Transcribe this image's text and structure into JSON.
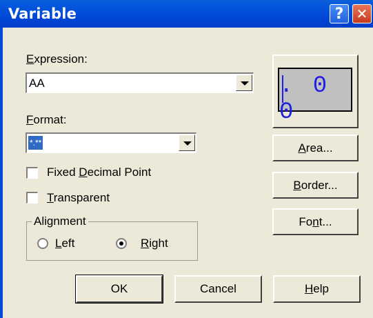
{
  "window": {
    "title": "Variable"
  },
  "titlebar_buttons": {
    "help_icon": "?",
    "close_icon": "✕"
  },
  "expression": {
    "label": "Expression:",
    "label_mnemonic": "E",
    "label_rest": "xpression:",
    "value": "AA"
  },
  "format": {
    "label_mnemonic": "F",
    "label_rest": "ormat:",
    "value": "*.**"
  },
  "options": {
    "fixed_decimal": {
      "pre": "Fixed ",
      "mnemonic": "D",
      "post": "ecimal Point",
      "checked": false
    },
    "transparent": {
      "mnemonic": "T",
      "post": "ransparent",
      "checked": false
    }
  },
  "alignment": {
    "legend": "Alignment",
    "left": {
      "mnemonic": "L",
      "post": "eft",
      "selected": false
    },
    "right": {
      "mnemonic": "R",
      "post": "ight",
      "selected": true
    }
  },
  "preview": {
    "text": "0.00",
    "display": ". 0 0",
    "color": "#2020e0"
  },
  "side_buttons": {
    "area": {
      "mnemonic": "A",
      "post": "rea..."
    },
    "border": {
      "mnemonic": "B",
      "post": "order..."
    },
    "font": {
      "pre": "Fo",
      "mnemonic": "n",
      "post": "t..."
    }
  },
  "bottom_buttons": {
    "ok": "OK",
    "cancel": "Cancel",
    "help": {
      "mnemonic": "H",
      "post": "elp"
    }
  }
}
